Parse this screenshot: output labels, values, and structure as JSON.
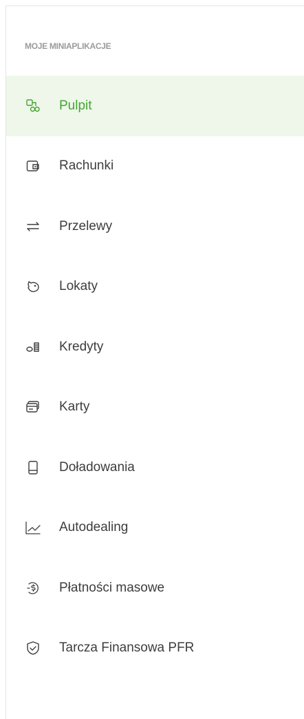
{
  "section": {
    "title": "MOJE MINIAPLIKACJE"
  },
  "colors": {
    "active_text": "#44a430",
    "active_bg": "#eef7ea",
    "text": "#3d3d3d",
    "muted": "#9a9a9a"
  },
  "menu": {
    "items": [
      {
        "label": "Pulpit",
        "icon": "dashboard-icon",
        "active": true
      },
      {
        "label": "Rachunki",
        "icon": "wallet-icon",
        "active": false
      },
      {
        "label": "Przelewy",
        "icon": "transfer-arrows-icon",
        "active": false
      },
      {
        "label": "Lokaty",
        "icon": "piggy-bank-icon",
        "active": false
      },
      {
        "label": "Kredyty",
        "icon": "coins-icon",
        "active": false
      },
      {
        "label": "Karty",
        "icon": "cards-icon",
        "active": false
      },
      {
        "label": "Doładowania",
        "icon": "phone-icon",
        "active": false
      },
      {
        "label": "Autodealing",
        "icon": "chart-line-icon",
        "active": false
      },
      {
        "label": "Płatności masowe",
        "icon": "dollar-cycle-icon",
        "active": false
      },
      {
        "label": "Tarcza Finansowa PFR",
        "icon": "shield-check-icon",
        "active": false
      }
    ]
  }
}
